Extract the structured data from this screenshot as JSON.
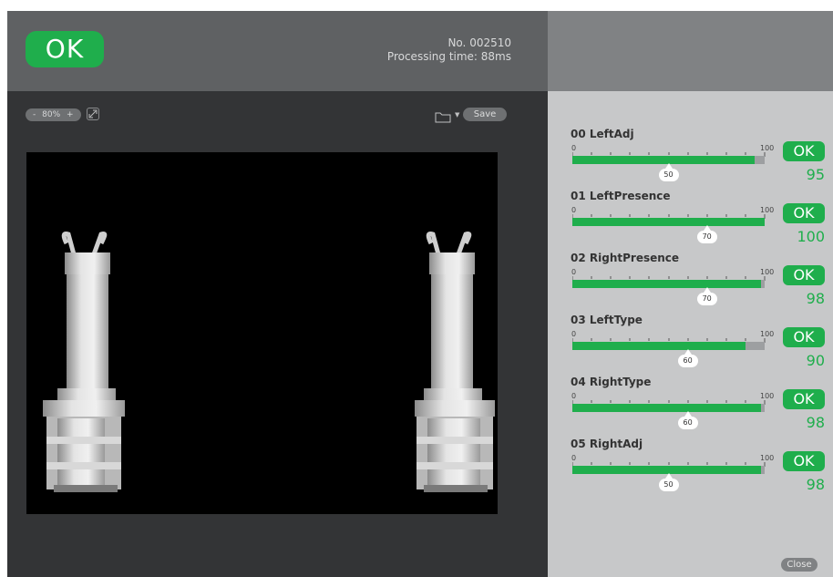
{
  "header": {
    "status": "OK",
    "number": "No. 002510",
    "processing_time": "Processing time: 88ms"
  },
  "toolbar": {
    "zoom_minus": "-",
    "zoom_level": "80%",
    "zoom_plus": "+",
    "save_label": "Save"
  },
  "colors": {
    "ok_green": "#1fae4c",
    "panel_bg": "#c7c8c9",
    "viewer_bg": "#333436"
  },
  "inspections": [
    {
      "name": "00 LeftAdj",
      "min": "0",
      "max": "100",
      "threshold": "50",
      "threshold_value": 50,
      "fill_percent": 95,
      "status": "OK",
      "score": "95"
    },
    {
      "name": "01 LeftPresence",
      "min": "0",
      "max": "100",
      "threshold": "70",
      "threshold_value": 70,
      "fill_percent": 100,
      "status": "OK",
      "score": "100"
    },
    {
      "name": "02 RightPresence",
      "min": "0",
      "max": "100",
      "threshold": "70",
      "threshold_value": 70,
      "fill_percent": 98,
      "status": "OK",
      "score": "98"
    },
    {
      "name": "03 LeftType",
      "min": "0",
      "max": "100",
      "threshold": "60",
      "threshold_value": 60,
      "fill_percent": 90,
      "status": "OK",
      "score": "90"
    },
    {
      "name": "04 RightType",
      "min": "0",
      "max": "100",
      "threshold": "60",
      "threshold_value": 60,
      "fill_percent": 98,
      "status": "OK",
      "score": "98"
    },
    {
      "name": "05 RightAdj",
      "min": "0",
      "max": "100",
      "threshold": "50",
      "threshold_value": 50,
      "fill_percent": 98,
      "status": "OK",
      "score": "98"
    }
  ],
  "footer": {
    "close_label": "Close"
  }
}
